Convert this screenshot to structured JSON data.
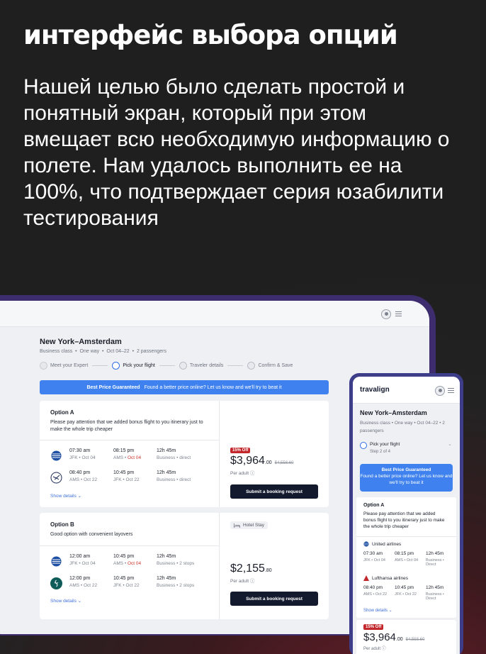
{
  "headline": "интерфейс выбора опций",
  "lede": "Нашей целью было сделать простой и понятный экран, который при этом вмещает всю необходимую информацию о полете. Нам удалось выполнить ее на 100%, что подтверждает серия юзабилити тестирования",
  "colors": {
    "accent": "#3f82ef",
    "dark_button": "#131a2e",
    "discount": "#c2282b",
    "frame": "#3e2d6e"
  },
  "desktop": {
    "title": "New York–Amsterdam",
    "subtitle": [
      "Business class",
      "One way",
      "Oct 04–22",
      "2 passengers"
    ],
    "steps": [
      {
        "label": "Meet your Expert",
        "state": "done"
      },
      {
        "label": "Pick your flight",
        "state": "active"
      },
      {
        "label": "Traveler details",
        "state": "todo"
      },
      {
        "label": "Confirm & Save",
        "state": "todo"
      }
    ],
    "banner": {
      "bold": "Best Price Guaranteed",
      "text": "Found a better price online? Let us know and we'll try to beat it"
    },
    "optionA": {
      "title": "Option A",
      "desc": "Please pay attention that we added bonus flight to you itinerary just to make the whole trip cheaper",
      "legs": [
        {
          "dep": "07:30 am",
          "dep_sub": "JFK • Oct 04",
          "arr": "08:15 pm",
          "arr_sub_a": "AMS • ",
          "arr_sub_b": "Oct 04",
          "dur": "12h 45m",
          "dur_sub": "Business • direct",
          "logo": "united-airlines-logo"
        },
        {
          "dep": "08:40 pm",
          "dep_sub": "AMS • Oct 22",
          "arr": "10:45 pm",
          "arr_sub_a": "JFK • Oct 22",
          "arr_sub_b": "",
          "dur": "12h 45m",
          "dur_sub": "Business • direct",
          "logo": "lufthansa-logo"
        }
      ],
      "details": "Show details ⌄",
      "badge": "15% Off",
      "price_main": "$3,964",
      "price_cents": ".00",
      "price_old": "$4,558.60",
      "per": "Per adult ⓘ",
      "button": "Submit a booking request"
    },
    "optionB": {
      "title": "Option B",
      "desc": "Good option with convenient layovers",
      "hotel": "Hotel Stay",
      "legs": [
        {
          "dep": "12:00 am",
          "dep_sub": "JFK • Oct 04",
          "arr": "10:45 pm",
          "arr_sub_a": "AMS • ",
          "arr_sub_b": "Oct 04",
          "dur": "12h 45m",
          "dur_sub": "Business • 2 stops",
          "logo": "united-airlines-logo"
        },
        {
          "dep": "12:00 pm",
          "dep_sub": "AMS • Oct 22",
          "arr": "10:45 pm",
          "arr_sub_a": "JFK • Oct 22",
          "arr_sub_b": "",
          "dur": "12h 45m",
          "dur_sub": "Business • 2 stops",
          "logo": "aer-lingus-logo"
        }
      ],
      "details": "Show details ⌄",
      "price_main": "$2,155",
      "price_cents": ".80",
      "per": "Per adult ⓘ",
      "button": "Submit a booking request"
    }
  },
  "mobile": {
    "brand": "travalign",
    "title": "New York–Amsterdam",
    "subtitle": "Business class • One way • Oct 04–22 • 2 passengers",
    "step_label": "Pick your flight",
    "step_sub": "Step 2 of 4",
    "banner_bold": "Best Price Guaranteed",
    "banner_text": "Found a better price online? Let us know and we'll try to beat it",
    "option_title": "Option A",
    "option_desc": "Please pay attention that we added bonus flight to you itinerary just to make the whole trip cheaper",
    "airline1": "United airlines",
    "leg1": {
      "dep": "07:30 am",
      "dep_sub": "JFK • Oct 04",
      "arr": "08:15 pm",
      "arr_sub": "AMS • Oct 04",
      "dur": "12h 45m",
      "dur_sub": "Business • Direct"
    },
    "airline2": "Lufthansa airlines",
    "leg2": {
      "dep": "08:40 pm",
      "dep_sub": "AMS • Oct 22",
      "arr": "10:45 pm",
      "arr_sub": "JFK • Oct 22",
      "dur": "12h 45m",
      "dur_sub": "Business • Direct"
    },
    "details": "Show details ⌄",
    "badge": "15% Off",
    "price_main": "$3,964",
    "price_cents": ".00",
    "price_old": "$4,558.60",
    "per": "Per adult ⓘ"
  }
}
